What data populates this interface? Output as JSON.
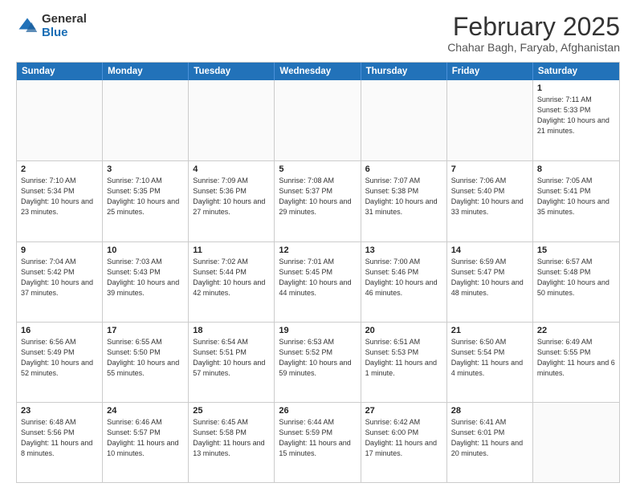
{
  "header": {
    "logo_general": "General",
    "logo_blue": "Blue",
    "title": "February 2025",
    "location": "Chahar Bagh, Faryab, Afghanistan"
  },
  "weekdays": [
    "Sunday",
    "Monday",
    "Tuesday",
    "Wednesday",
    "Thursday",
    "Friday",
    "Saturday"
  ],
  "weeks": [
    [
      {
        "date": "",
        "info": ""
      },
      {
        "date": "",
        "info": ""
      },
      {
        "date": "",
        "info": ""
      },
      {
        "date": "",
        "info": ""
      },
      {
        "date": "",
        "info": ""
      },
      {
        "date": "",
        "info": ""
      },
      {
        "date": "1",
        "info": "Sunrise: 7:11 AM\nSunset: 5:33 PM\nDaylight: 10 hours and 21 minutes."
      }
    ],
    [
      {
        "date": "2",
        "info": "Sunrise: 7:10 AM\nSunset: 5:34 PM\nDaylight: 10 hours and 23 minutes."
      },
      {
        "date": "3",
        "info": "Sunrise: 7:10 AM\nSunset: 5:35 PM\nDaylight: 10 hours and 25 minutes."
      },
      {
        "date": "4",
        "info": "Sunrise: 7:09 AM\nSunset: 5:36 PM\nDaylight: 10 hours and 27 minutes."
      },
      {
        "date": "5",
        "info": "Sunrise: 7:08 AM\nSunset: 5:37 PM\nDaylight: 10 hours and 29 minutes."
      },
      {
        "date": "6",
        "info": "Sunrise: 7:07 AM\nSunset: 5:38 PM\nDaylight: 10 hours and 31 minutes."
      },
      {
        "date": "7",
        "info": "Sunrise: 7:06 AM\nSunset: 5:40 PM\nDaylight: 10 hours and 33 minutes."
      },
      {
        "date": "8",
        "info": "Sunrise: 7:05 AM\nSunset: 5:41 PM\nDaylight: 10 hours and 35 minutes."
      }
    ],
    [
      {
        "date": "9",
        "info": "Sunrise: 7:04 AM\nSunset: 5:42 PM\nDaylight: 10 hours and 37 minutes."
      },
      {
        "date": "10",
        "info": "Sunrise: 7:03 AM\nSunset: 5:43 PM\nDaylight: 10 hours and 39 minutes."
      },
      {
        "date": "11",
        "info": "Sunrise: 7:02 AM\nSunset: 5:44 PM\nDaylight: 10 hours and 42 minutes."
      },
      {
        "date": "12",
        "info": "Sunrise: 7:01 AM\nSunset: 5:45 PM\nDaylight: 10 hours and 44 minutes."
      },
      {
        "date": "13",
        "info": "Sunrise: 7:00 AM\nSunset: 5:46 PM\nDaylight: 10 hours and 46 minutes."
      },
      {
        "date": "14",
        "info": "Sunrise: 6:59 AM\nSunset: 5:47 PM\nDaylight: 10 hours and 48 minutes."
      },
      {
        "date": "15",
        "info": "Sunrise: 6:57 AM\nSunset: 5:48 PM\nDaylight: 10 hours and 50 minutes."
      }
    ],
    [
      {
        "date": "16",
        "info": "Sunrise: 6:56 AM\nSunset: 5:49 PM\nDaylight: 10 hours and 52 minutes."
      },
      {
        "date": "17",
        "info": "Sunrise: 6:55 AM\nSunset: 5:50 PM\nDaylight: 10 hours and 55 minutes."
      },
      {
        "date": "18",
        "info": "Sunrise: 6:54 AM\nSunset: 5:51 PM\nDaylight: 10 hours and 57 minutes."
      },
      {
        "date": "19",
        "info": "Sunrise: 6:53 AM\nSunset: 5:52 PM\nDaylight: 10 hours and 59 minutes."
      },
      {
        "date": "20",
        "info": "Sunrise: 6:51 AM\nSunset: 5:53 PM\nDaylight: 11 hours and 1 minute."
      },
      {
        "date": "21",
        "info": "Sunrise: 6:50 AM\nSunset: 5:54 PM\nDaylight: 11 hours and 4 minutes."
      },
      {
        "date": "22",
        "info": "Sunrise: 6:49 AM\nSunset: 5:55 PM\nDaylight: 11 hours and 6 minutes."
      }
    ],
    [
      {
        "date": "23",
        "info": "Sunrise: 6:48 AM\nSunset: 5:56 PM\nDaylight: 11 hours and 8 minutes."
      },
      {
        "date": "24",
        "info": "Sunrise: 6:46 AM\nSunset: 5:57 PM\nDaylight: 11 hours and 10 minutes."
      },
      {
        "date": "25",
        "info": "Sunrise: 6:45 AM\nSunset: 5:58 PM\nDaylight: 11 hours and 13 minutes."
      },
      {
        "date": "26",
        "info": "Sunrise: 6:44 AM\nSunset: 5:59 PM\nDaylight: 11 hours and 15 minutes."
      },
      {
        "date": "27",
        "info": "Sunrise: 6:42 AM\nSunset: 6:00 PM\nDaylight: 11 hours and 17 minutes."
      },
      {
        "date": "28",
        "info": "Sunrise: 6:41 AM\nSunset: 6:01 PM\nDaylight: 11 hours and 20 minutes."
      },
      {
        "date": "",
        "info": ""
      }
    ]
  ]
}
